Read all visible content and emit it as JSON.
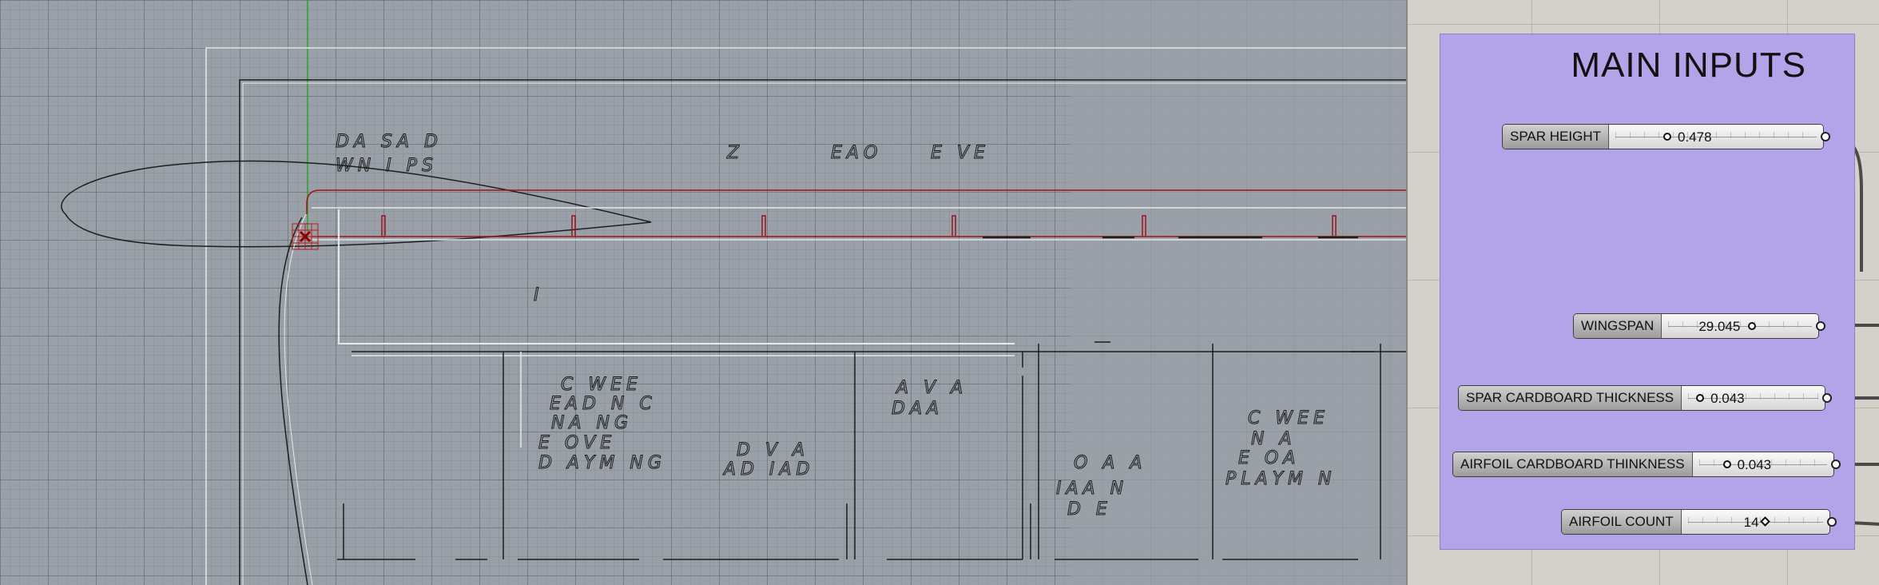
{
  "viewport": {
    "name": "Rhino viewport",
    "sketch_labels": [
      "DA SA D",
      "WN I PS",
      "Z",
      "EAO",
      "E VE",
      "I",
      "C WEE",
      "EAD N C",
      "NA NG",
      "E OVE",
      "D AYM NG",
      "D V A",
      "AD IAD",
      "A V A",
      "DAA",
      "O A A",
      "IAA N",
      "D E",
      "C WEE",
      "N A",
      "E OA",
      "PLAYM N"
    ]
  },
  "canvas": {
    "group_title": "MAIN INPUTS",
    "group_color": "#b3a3e8",
    "sliders": [
      {
        "label": "SPAR HEIGHT",
        "value": "0.478",
        "fraction": 0.35,
        "knob": "circle"
      },
      {
        "label": "WINGSPAN",
        "value": "29.045",
        "fraction": 0.58,
        "knob": "circle"
      },
      {
        "label": "SPAR CARDBOARD THICKNESS",
        "value": "0.043",
        "fraction": 0.1,
        "knob": "circle"
      },
      {
        "label": "AIRFOIL CARDBOARD THINKNESS",
        "value": "0.043",
        "fraction": 0.22,
        "knob": "circle"
      },
      {
        "label": "AIRFOIL COUNT",
        "value": "14",
        "fraction": 0.68,
        "knob": "diamond"
      }
    ]
  }
}
